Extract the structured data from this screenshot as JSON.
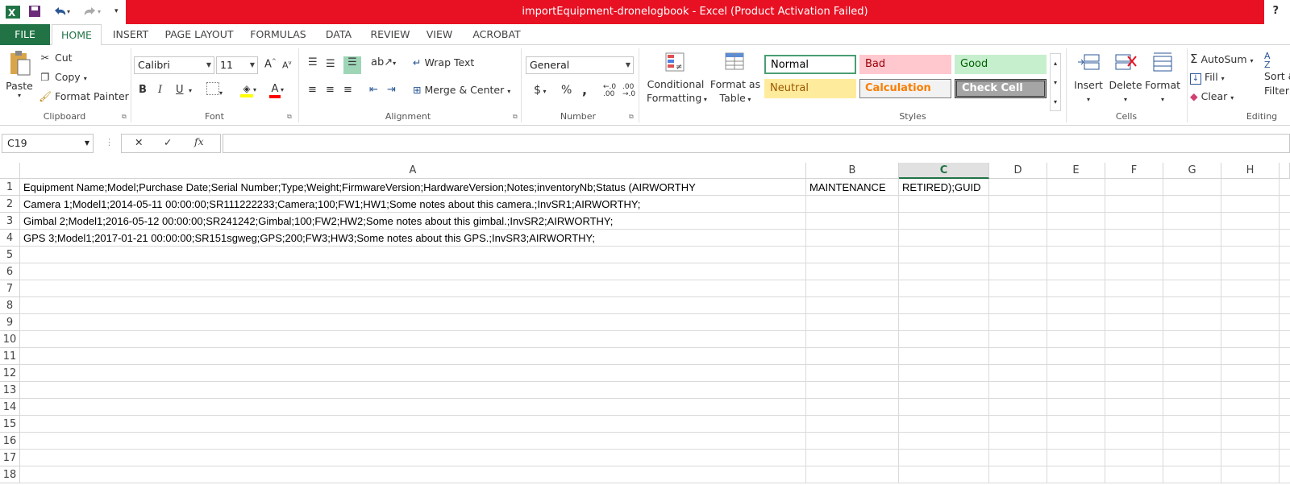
{
  "window": {
    "title": "importEquipment-dronelogbook -  Excel (Product Activation Failed)",
    "help": "?"
  },
  "tabs": [
    {
      "label": "FILE"
    },
    {
      "label": "HOME"
    },
    {
      "label": "INSERT"
    },
    {
      "label": "PAGE LAYOUT"
    },
    {
      "label": "FORMULAS"
    },
    {
      "label": "DATA"
    },
    {
      "label": "REVIEW"
    },
    {
      "label": "VIEW"
    },
    {
      "label": "ACROBAT"
    }
  ],
  "clipboard": {
    "paste": "Paste",
    "cut": "Cut",
    "copy": "Copy",
    "format_painter": "Format Painter",
    "label": "Clipboard"
  },
  "font": {
    "name": "Calibri",
    "size": "11",
    "label": "Font",
    "bold": "B",
    "italic": "I",
    "underline": "U",
    "grow": "A",
    "shrink": "A",
    "color": "A"
  },
  "alignment": {
    "wrap_text": "Wrap Text",
    "merge_center": "Merge & Center",
    "label": "Alignment"
  },
  "number": {
    "format": "General",
    "label": "Number",
    "currency": "$",
    "percent": "%",
    "comma": ","
  },
  "styles": {
    "conditional": "Conditional",
    "formatting": "Formatting",
    "format_as": "Format as",
    "table": "Table",
    "normal": "Normal",
    "bad": "Bad",
    "good": "Good",
    "neutral": "Neutral",
    "calculation": "Calculation",
    "check_cell": "Check Cell",
    "label": "Styles"
  },
  "cells": {
    "insert": "Insert",
    "delete": "Delete",
    "format": "Format",
    "label": "Cells"
  },
  "editing": {
    "autosum": "AutoSum",
    "fill": "Fill",
    "clear": "Clear",
    "sort": "Sort &",
    "filter": "Filter",
    "label": "Editing"
  },
  "formula_bar": {
    "name_box": "C19",
    "fx": "fx",
    "value": ""
  },
  "columns": [
    "A",
    "B",
    "C",
    "D",
    "E",
    "F",
    "G",
    "H"
  ],
  "rows": [
    "1",
    "2",
    "3",
    "4",
    "5",
    "6",
    "7",
    "8",
    "9",
    "10",
    "11",
    "12",
    "13",
    "14",
    "15",
    "16",
    "17",
    "18"
  ],
  "data": {
    "r1a": "Equipment Name;Model;Purchase Date;Serial Number;Type;Weight;FirmwareVersion;HardwareVersion;Notes;inventoryNb;Status (AIRWORTHY",
    "r1b": "MAINTENANCE",
    "r1c": "RETIRED);GUID",
    "r2a": "Camera 1;Model1;2014-05-11 00:00:00;SR111222233;Camera;100;FW1;HW1;Some notes about this camera.;InvSR1;AIRWORTHY;",
    "r3a": "Gimbal 2;Model1;2016-05-12 00:00:00;SR241242;Gimbal;100;FW2;HW2;Some notes about this gimbal.;InvSR2;AIRWORTHY;",
    "r4a": "GPS 3;Model1;2017-01-21 00:00:00;SR151sgweg;GPS;200;FW3;HW3;Some notes about this GPS.;InvSR3;AIRWORTHY;"
  }
}
